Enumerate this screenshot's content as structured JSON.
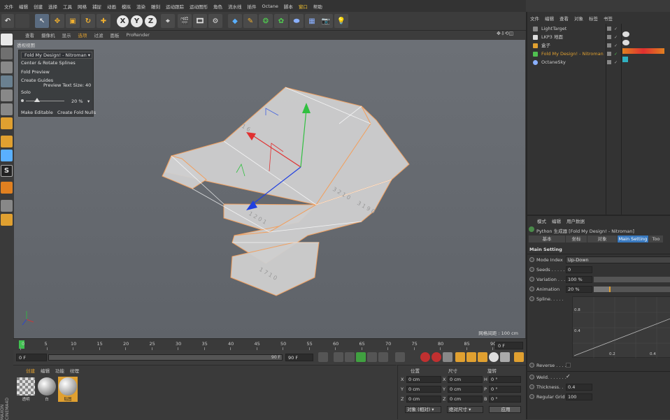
{
  "menubar": {
    "items": [
      "文件",
      "编辑",
      "创建",
      "选择",
      "工具",
      "网格",
      "捕捉",
      "动画",
      "模拟",
      "渲染",
      "雕刻",
      "运动跟踪",
      "运动图形",
      "角色",
      "流水线",
      "插件",
      "Octane",
      "脚本",
      "窗口",
      "帮助"
    ],
    "highlighted": [
      "窗口"
    ]
  },
  "toolbar": {
    "axis_x": "X",
    "axis_y": "Y",
    "axis_z": "Z"
  },
  "viewport_menu": {
    "items": [
      "查看",
      "摄像机",
      "显示",
      "选项",
      "过滤",
      "面板",
      "ProRender"
    ],
    "active": "选项"
  },
  "viewport": {
    "label": "透视视图",
    "grid_spacing": "网格间距 : 100 cm"
  },
  "plugin_panel": {
    "title": "Fold My Design! - Nitroman",
    "center_rotate": "Center & Rotate Splines",
    "fold_preview": "Fold Preview",
    "create_guides": "Create Guides",
    "preview_text_size_label": "Preview Text Size:",
    "preview_text_size_value": "40",
    "solo": "Solo",
    "slider_value": "20 %",
    "make_editable": "Make Editable",
    "create_fold_nulls": "Create Fold Nulls"
  },
  "timeline": {
    "ticks": [
      "0",
      "5",
      "10",
      "15",
      "20",
      "25",
      "30",
      "35",
      "40",
      "45",
      "50",
      "55",
      "60",
      "65",
      "70",
      "75",
      "80",
      "85",
      "90"
    ],
    "current_frame": "0 F",
    "start": "0 F",
    "range_end_inner": "90 F",
    "end": "90 F"
  },
  "material_manager": {
    "tabs": [
      "创建",
      "编辑",
      "功能",
      "纹理"
    ],
    "materials": [
      {
        "name": "透明"
      },
      {
        "name": "白"
      },
      {
        "name": "贴图"
      }
    ]
  },
  "coordinates": {
    "headers": [
      "位置",
      "尺寸",
      "旋转"
    ],
    "rows": [
      {
        "axis": "X",
        "pos": "0 cm",
        "size_axis": "X",
        "size": "0 cm",
        "rot_axis": "H",
        "rot": "0 °"
      },
      {
        "axis": "Y",
        "pos": "0 cm",
        "size_axis": "Y",
        "size": "0 cm",
        "rot_axis": "P",
        "rot": "0 °"
      },
      {
        "axis": "Z",
        "pos": "0 cm",
        "size_axis": "Z",
        "size": "0 cm",
        "rot_axis": "B",
        "rot": "0 °"
      }
    ],
    "mode_select": "对象 (相对)",
    "size_select": "绝对尺寸",
    "apply": "应用"
  },
  "object_manager": {
    "menu": [
      "文件",
      "编辑",
      "查看",
      "对象",
      "标签",
      "书签"
    ],
    "objects": [
      {
        "name": "LightTarget"
      },
      {
        "name": "LKP3 地面"
      },
      {
        "name": "盒子"
      },
      {
        "name": "Fold My Design! - Nitroman"
      },
      {
        "name": "OctaneSky"
      }
    ]
  },
  "attribute_manager": {
    "menu": [
      "模式",
      "编辑",
      "用户数据"
    ],
    "title": "Python 生成器 [Fold My Design! - Nitroman]",
    "tabs": [
      "基本",
      "坐标",
      "对象",
      "Main Setting",
      "Too"
    ],
    "active_tab": "Main Setting",
    "section": "Main Setting",
    "mode_index_label": "Mode Index",
    "mode_index_value": "Up-Down",
    "seeds_label": "Seeds . . . . . .",
    "seeds_value": "0",
    "variation_label": "Variation . . .",
    "variation_value": "100 %",
    "animation_label": "Animation",
    "animation_value": "20 %",
    "spline_label": "Spline. . . . .",
    "graph_y": [
      "0.8",
      "0.4"
    ],
    "graph_x": [
      "0.2",
      "0.4"
    ],
    "reverse_label": "Reverse . . . . .",
    "weld_label": "Weld. . . . . . .",
    "thickness_label": "Thickness. .",
    "thickness_value": "0.4",
    "regular_grid_label": "Regular Grid",
    "regular_grid_value": "100"
  },
  "colors": {
    "accent": "#e0a030",
    "axis_x": "#e03030",
    "axis_y": "#30c040",
    "axis_z": "#2040e0",
    "box_outline": "#f0a060"
  }
}
